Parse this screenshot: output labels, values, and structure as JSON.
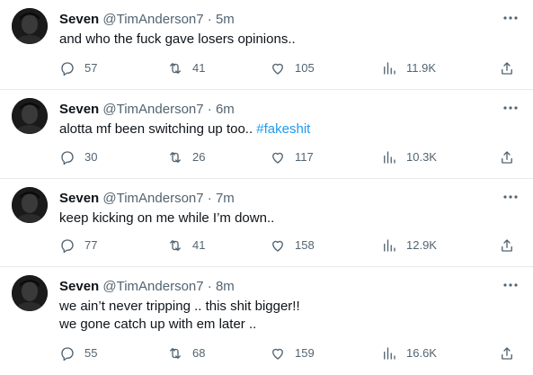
{
  "tweets": [
    {
      "name": "Seven",
      "handle": "@TimAnderson7",
      "separator": "·",
      "time": "5m",
      "text": "and who the fuck gave losers opinions..",
      "hashtag": "",
      "text_line2": "",
      "replies": "57",
      "retweets": "41",
      "likes": "105",
      "views": "11.9K"
    },
    {
      "name": "Seven",
      "handle": "@TimAnderson7",
      "separator": "·",
      "time": "6m",
      "text": "alotta mf been switching up too.. ",
      "hashtag": "#fakeshit",
      "text_line2": "",
      "replies": "30",
      "retweets": "26",
      "likes": "117",
      "views": "10.3K"
    },
    {
      "name": "Seven",
      "handle": "@TimAnderson7",
      "separator": "·",
      "time": "7m",
      "text": "keep kicking on me while I’m down..",
      "hashtag": "",
      "text_line2": "",
      "replies": "77",
      "retweets": "41",
      "likes": "158",
      "views": "12.9K"
    },
    {
      "name": "Seven",
      "handle": "@TimAnderson7",
      "separator": "·",
      "time": "8m",
      "text": "we ain’t never tripping .. this shit bigger!!",
      "hashtag": "",
      "text_line2": "we gone catch up with em later ..",
      "replies": "55",
      "retweets": "68",
      "likes": "159",
      "views": "16.6K"
    }
  ],
  "icons": {
    "reply": "reply-icon",
    "retweet": "retweet-icon",
    "like": "heart-icon",
    "views": "views-icon",
    "share": "share-icon",
    "more": "more-icon"
  },
  "colors": {
    "text": "#0f1419",
    "muted": "#536471",
    "link": "#1d9bf0",
    "divider": "#e7e9ea"
  }
}
